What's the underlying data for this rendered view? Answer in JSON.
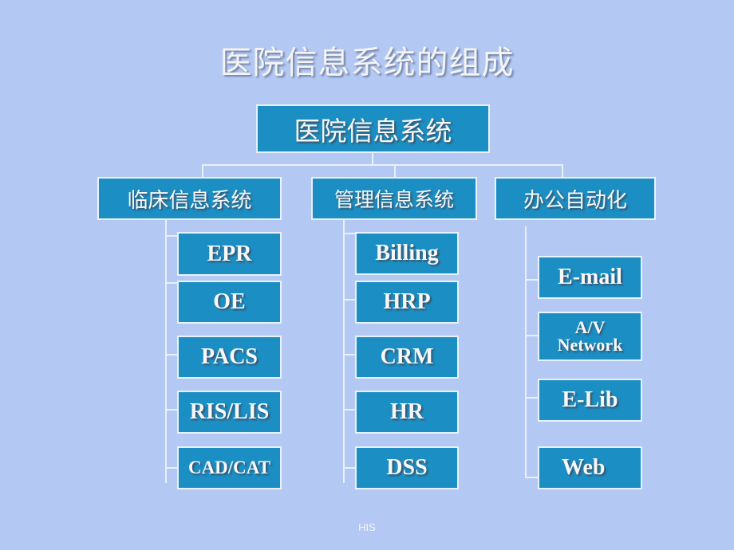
{
  "title": "医院信息系统的组成",
  "root": {
    "label": "医院信息系统"
  },
  "branches": [
    {
      "label": "临床信息系统",
      "children": [
        "EPR",
        "OE",
        "PACS",
        "RIS/LIS",
        "CAD/CAT"
      ]
    },
    {
      "label": "管理信息系统",
      "children": [
        "Billing",
        "HRP",
        "CRM",
        "HR",
        "DSS"
      ]
    },
    {
      "label": "办公自动化",
      "children": [
        "E-mail",
        "A/V Network",
        "E-Lib",
        "Web"
      ]
    }
  ],
  "av_network_lines": [
    "A/V",
    "Network"
  ],
  "footer": "HIS",
  "colors": {
    "background": "#b4c8f4",
    "box": "#1b8fc4",
    "border": "#e8f2fb"
  }
}
